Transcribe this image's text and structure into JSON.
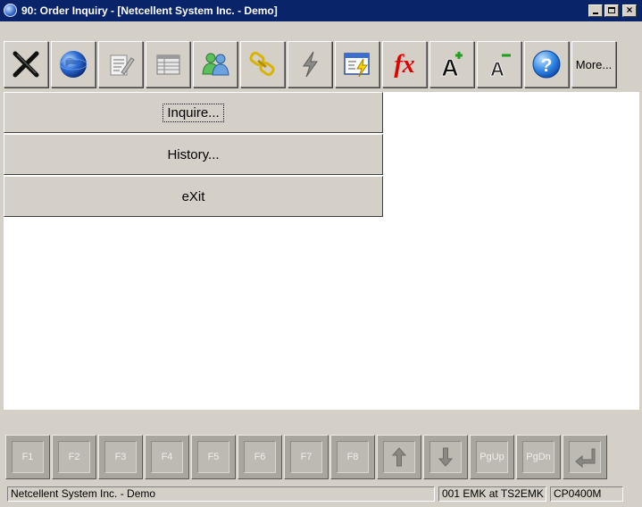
{
  "window": {
    "title": "90: Order Inquiry - [Netcellent System Inc. - Demo]"
  },
  "toolbar": {
    "buttons": [
      {
        "icon": "close-x-icon"
      },
      {
        "icon": "globe-icon"
      },
      {
        "icon": "edit-note-icon"
      },
      {
        "icon": "table-grid-icon"
      },
      {
        "icon": "users-icon"
      },
      {
        "icon": "chain-link-icon"
      },
      {
        "icon": "lightning-icon"
      },
      {
        "icon": "window-lightning-icon"
      },
      {
        "icon": "function-fx-icon",
        "label": "fx"
      },
      {
        "icon": "font-increase-icon",
        "label": "A"
      },
      {
        "icon": "font-decrease-icon",
        "label": "A"
      },
      {
        "icon": "help-icon",
        "label": "?"
      }
    ],
    "more_label": "More..."
  },
  "menu": {
    "inquire_label": "Inquire...",
    "history_label": "History...",
    "exit_label": "eXit"
  },
  "fkeys": {
    "f1": "F1",
    "f2": "F2",
    "f3": "F3",
    "f4": "F4",
    "f5": "F5",
    "f6": "F6",
    "f7": "F7",
    "f8": "F8",
    "pgup": "PgUp",
    "pgdn": "PgDn"
  },
  "status": {
    "company": "Netcellent System Inc. - Demo",
    "user": "001 EMK at TS2EMK",
    "program": "CP0400M"
  }
}
